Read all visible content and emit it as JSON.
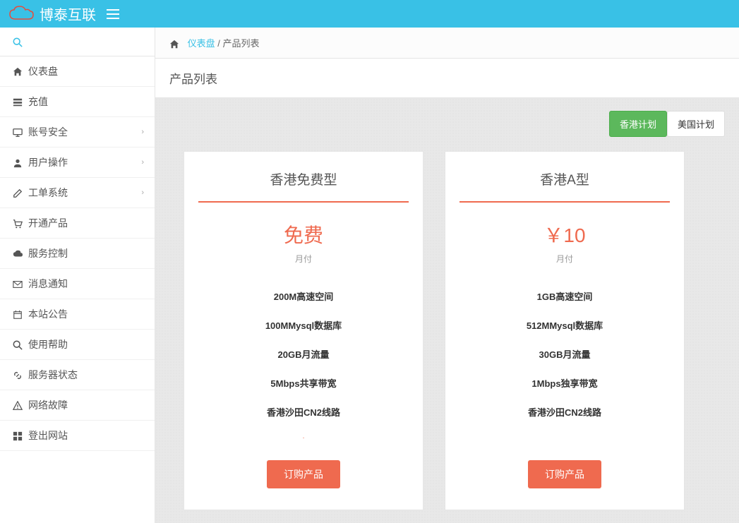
{
  "brand": "博泰互联",
  "breadcrumb": {
    "dashboard": "仪表盘",
    "current": "产品列表"
  },
  "page_title": "产品列表",
  "sidebar": {
    "items": [
      {
        "label": "仪表盘",
        "icon": "home",
        "expandable": false
      },
      {
        "label": "充值",
        "icon": "tasks",
        "expandable": false
      },
      {
        "label": "账号安全",
        "icon": "desktop",
        "expandable": true
      },
      {
        "label": "用户操作",
        "icon": "user",
        "expandable": true
      },
      {
        "label": "工单系统",
        "icon": "edit",
        "expandable": true
      },
      {
        "label": "开通产品",
        "icon": "cart",
        "expandable": false
      },
      {
        "label": "服务控制",
        "icon": "cloud",
        "expandable": false
      },
      {
        "label": "消息通知",
        "icon": "envelope",
        "expandable": false
      },
      {
        "label": "本站公告",
        "icon": "calendar",
        "expandable": false
      },
      {
        "label": "使用帮助",
        "icon": "search",
        "expandable": false
      },
      {
        "label": "服务器状态",
        "icon": "link",
        "expandable": false
      },
      {
        "label": "网络故障",
        "icon": "warning",
        "expandable": false
      },
      {
        "label": "登出网站",
        "icon": "windows",
        "expandable": false
      }
    ]
  },
  "plan_tabs": [
    {
      "label": "香港计划",
      "active": true
    },
    {
      "label": "美国计划",
      "active": false
    }
  ],
  "products": [
    {
      "title": "香港免费型",
      "price": "免费",
      "cycle": "月付",
      "features": [
        "200M高速空间",
        "100MMysql数据库",
        "20GB月流量",
        "5Mbps共享带宽",
        "香港沙田CN2线路"
      ],
      "show_dot": true,
      "button": "订购产品"
    },
    {
      "title": "香港A型",
      "price": "￥10",
      "cycle": "月付",
      "features": [
        "1GB高速空间",
        "512MMysql数据库",
        "30GB月流量",
        "1Mbps独享带宽",
        "香港沙田CN2线路"
      ],
      "show_dot": false,
      "button": "订购产品"
    }
  ]
}
